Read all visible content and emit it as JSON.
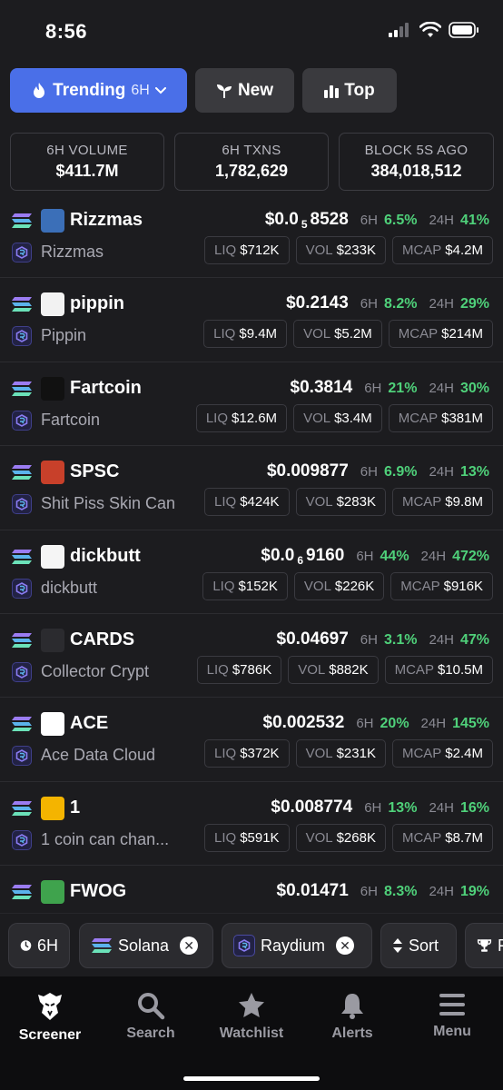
{
  "status": {
    "time": "8:56"
  },
  "tabs": [
    {
      "label": "Trending",
      "suffix": "6H"
    },
    {
      "label": "New"
    },
    {
      "label": "Top"
    }
  ],
  "stats": [
    {
      "label": "6H VOLUME",
      "value": "$411.7M"
    },
    {
      "label": "6H TXNS",
      "value": "1,782,629"
    },
    {
      "label": "BLOCK 5S AGO",
      "value": "384,018,512"
    }
  ],
  "tokens": [
    {
      "symbol": "Rizzmas",
      "name": "Rizzmas",
      "price_prefix": "$0.0",
      "price_sub": "5",
      "price_rest": "8528",
      "tf1": "6H",
      "chg6h": "6.5%",
      "tf2": "24H",
      "chg24h": "41%",
      "liq_label": "LIQ",
      "liq": "$712K",
      "vol_label": "VOL",
      "vol": "$233K",
      "mcap_label": "MCAP",
      "mcap": "$4.2M",
      "logo_color": "#3b6fb8"
    },
    {
      "symbol": "pippin",
      "name": "Pippin",
      "price_prefix": "$0.2143",
      "price_sub": "",
      "price_rest": "",
      "tf1": "6H",
      "chg6h": "8.2%",
      "tf2": "24H",
      "chg24h": "29%",
      "liq_label": "LIQ",
      "liq": "$9.4M",
      "vol_label": "VOL",
      "vol": "$5.2M",
      "mcap_label": "MCAP",
      "mcap": "$214M",
      "logo_color": "#f2f2f2"
    },
    {
      "symbol": "Fartcoin",
      "name": "Fartcoin",
      "price_prefix": "$0.3814",
      "price_sub": "",
      "price_rest": "",
      "tf1": "6H",
      "chg6h": "21%",
      "tf2": "24H",
      "chg24h": "30%",
      "liq_label": "LIQ",
      "liq": "$12.6M",
      "vol_label": "VOL",
      "vol": "$3.4M",
      "mcap_label": "MCAP",
      "mcap": "$381M",
      "logo_color": "#111111"
    },
    {
      "symbol": "SPSC",
      "name": "Shit Piss Skin Can",
      "price_prefix": "$0.009877",
      "price_sub": "",
      "price_rest": "",
      "tf1": "6H",
      "chg6h": "6.9%",
      "tf2": "24H",
      "chg24h": "13%",
      "liq_label": "LIQ",
      "liq": "$424K",
      "vol_label": "VOL",
      "vol": "$283K",
      "mcap_label": "MCAP",
      "mcap": "$9.8M",
      "logo_color": "#c8402a"
    },
    {
      "symbol": "dickbutt",
      "name": "dickbutt",
      "price_prefix": "$0.0",
      "price_sub": "6",
      "price_rest": "9160",
      "tf1": "6H",
      "chg6h": "44%",
      "tf2": "24H",
      "chg24h": "472%",
      "liq_label": "LIQ",
      "liq": "$152K",
      "vol_label": "VOL",
      "vol": "$226K",
      "mcap_label": "MCAP",
      "mcap": "$916K",
      "logo_color": "#f5f5f5"
    },
    {
      "symbol": "CARDS",
      "name": "Collector Crypt",
      "price_prefix": "$0.04697",
      "price_sub": "",
      "price_rest": "",
      "tf1": "6H",
      "chg6h": "3.1%",
      "tf2": "24H",
      "chg24h": "47%",
      "liq_label": "LIQ",
      "liq": "$786K",
      "vol_label": "VOL",
      "vol": "$882K",
      "mcap_label": "MCAP",
      "mcap": "$10.5M",
      "logo_color": "#2b2b2f"
    },
    {
      "symbol": "ACE",
      "name": "Ace Data Cloud",
      "price_prefix": "$0.002532",
      "price_sub": "",
      "price_rest": "",
      "tf1": "6H",
      "chg6h": "20%",
      "tf2": "24H",
      "chg24h": "145%",
      "liq_label": "LIQ",
      "liq": "$372K",
      "vol_label": "VOL",
      "vol": "$231K",
      "mcap_label": "MCAP",
      "mcap": "$2.4M",
      "logo_color": "#ffffff"
    },
    {
      "symbol": "1",
      "name": "1 coin can chan...",
      "price_prefix": "$0.008774",
      "price_sub": "",
      "price_rest": "",
      "tf1": "6H",
      "chg6h": "13%",
      "tf2": "24H",
      "chg24h": "16%",
      "liq_label": "LIQ",
      "liq": "$591K",
      "vol_label": "VOL",
      "vol": "$268K",
      "mcap_label": "MCAP",
      "mcap": "$8.7M",
      "logo_color": "#f4b400"
    },
    {
      "symbol": "FWOG",
      "name": "",
      "price_prefix": "$0.01471",
      "price_sub": "",
      "price_rest": "",
      "tf1": "6H",
      "chg6h": "8.3%",
      "tf2": "24H",
      "chg24h": "19%",
      "liq_label": "",
      "liq": "",
      "vol_label": "",
      "vol": "",
      "mcap_label": "",
      "mcap": "",
      "logo_color": "#3fa34d"
    }
  ],
  "filters": [
    {
      "label": "6H",
      "icon": "clock-icon"
    },
    {
      "label": "Solana",
      "icon": "solana-icon",
      "removable": true
    },
    {
      "label": "Raydium",
      "icon": "raydium-icon",
      "removable": true
    },
    {
      "label": "Sort",
      "icon": "sort-icon"
    },
    {
      "label": "F",
      "icon": "trophy-icon"
    }
  ],
  "nav": [
    {
      "label": "Screener",
      "icon": "eagle-icon"
    },
    {
      "label": "Search",
      "icon": "search-icon"
    },
    {
      "label": "Watchlist",
      "icon": "star-icon"
    },
    {
      "label": "Alerts",
      "icon": "bell-icon"
    },
    {
      "label": "Menu",
      "icon": "menu-icon"
    }
  ],
  "colors": {
    "accent": "#4a6fe8",
    "positive": "#4fd17a",
    "background": "#1c1c1f",
    "nav_background": "#0d0d0f"
  }
}
